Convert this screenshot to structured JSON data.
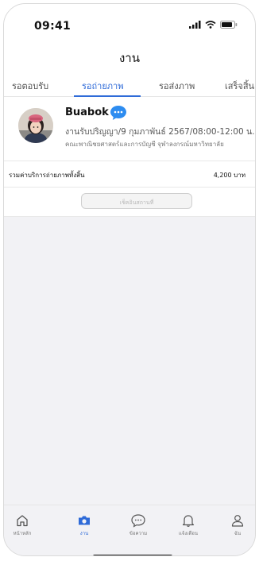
{
  "status_bar": {
    "time": "09:41"
  },
  "header": {
    "title": "งาน"
  },
  "tabs": [
    {
      "label": "รอตอบรับ",
      "active": false
    },
    {
      "label": "รอถ่ายภาพ",
      "active": true
    },
    {
      "label": "รอส่งภาพ",
      "active": false
    },
    {
      "label": "เสร็จสิ้น",
      "active": false
    }
  ],
  "job": {
    "name": "Buabok",
    "detail": "งานรับปริญญา/9 กุมภาพันธ์ 2567/08:00-12:00 น.",
    "location": "คณะพาณิชยศาสตร์และการบัญชี จุฬาลงกรณ์มหาวิทยาลัย"
  },
  "total": {
    "label": "รวมค่าบริการถ่ายภาพทั้งสิ้น",
    "value": "4,200 บาท"
  },
  "start_button": {
    "label": "เช็คอินสถานที่"
  },
  "bottom_nav": [
    {
      "label": "หน้าหลัก",
      "icon": "home-icon",
      "active": false
    },
    {
      "label": "งาน",
      "icon": "camera-icon",
      "active": true
    },
    {
      "label": "ข้อความ",
      "icon": "chat-bubble-icon",
      "active": false
    },
    {
      "label": "แจ้งเตือน",
      "icon": "bell-icon",
      "active": false
    },
    {
      "label": "ฉัน",
      "icon": "user-icon",
      "active": false
    }
  ],
  "colors": {
    "accent": "#2f6bd8",
    "chat_badge": "#2d8cf0"
  }
}
